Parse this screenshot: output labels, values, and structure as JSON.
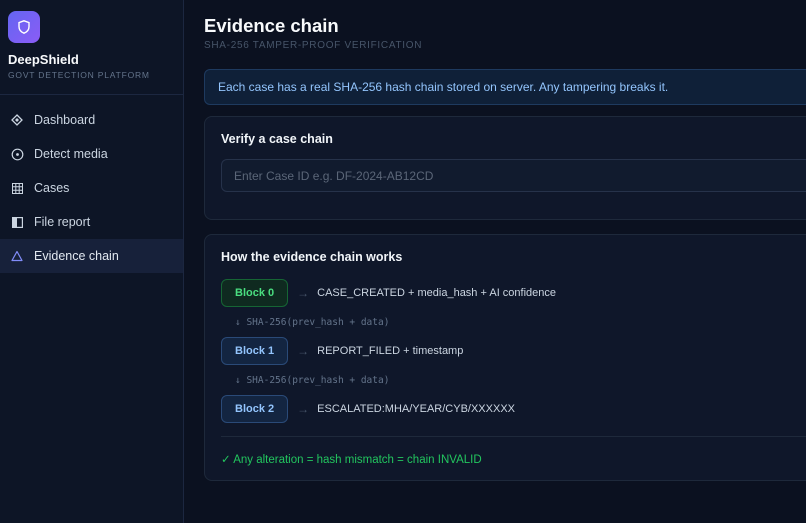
{
  "brand": {
    "name": "DeepShield",
    "subtitle": "GOVT DETECTION PLATFORM"
  },
  "sidebar": {
    "items": [
      {
        "label": "Dashboard",
        "icon": "diamond-icon"
      },
      {
        "label": "Detect media",
        "icon": "target-circle-icon"
      },
      {
        "label": "Cases",
        "icon": "grid-icon"
      },
      {
        "label": "File report",
        "icon": "split-panel-icon"
      },
      {
        "label": "Evidence chain",
        "icon": "warning-triangle-icon",
        "active": true
      }
    ]
  },
  "header": {
    "title": "Evidence chain",
    "subtitle": "SHA-256 TAMPER-PROOF VERIFICATION"
  },
  "banner": {
    "text": "Each case has a real SHA-256 hash chain stored on server. Any tampering breaks it."
  },
  "verify": {
    "title": "Verify a case chain",
    "placeholder": "Enter Case ID e.g. DF-2024-AB12CD"
  },
  "how": {
    "title": "How the evidence chain works",
    "arrow": "→",
    "blocks": [
      {
        "label": "Block 0",
        "desc": "CASE_CREATED + media_hash + AI confidence"
      },
      {
        "label": "Block 1",
        "desc": "REPORT_FILED + timestamp"
      },
      {
        "label": "Block 2",
        "desc": "ESCALATED:MHA/YEAR/CYB/XXXXXX"
      }
    ],
    "hash_link": "↓ SHA-256(prev_hash + data)",
    "footer": "✓ Any alteration = hash mismatch = chain INVALID"
  },
  "colors": {
    "accent": "#6366f1",
    "success": "#22c55e",
    "info": "#93c5fd"
  }
}
